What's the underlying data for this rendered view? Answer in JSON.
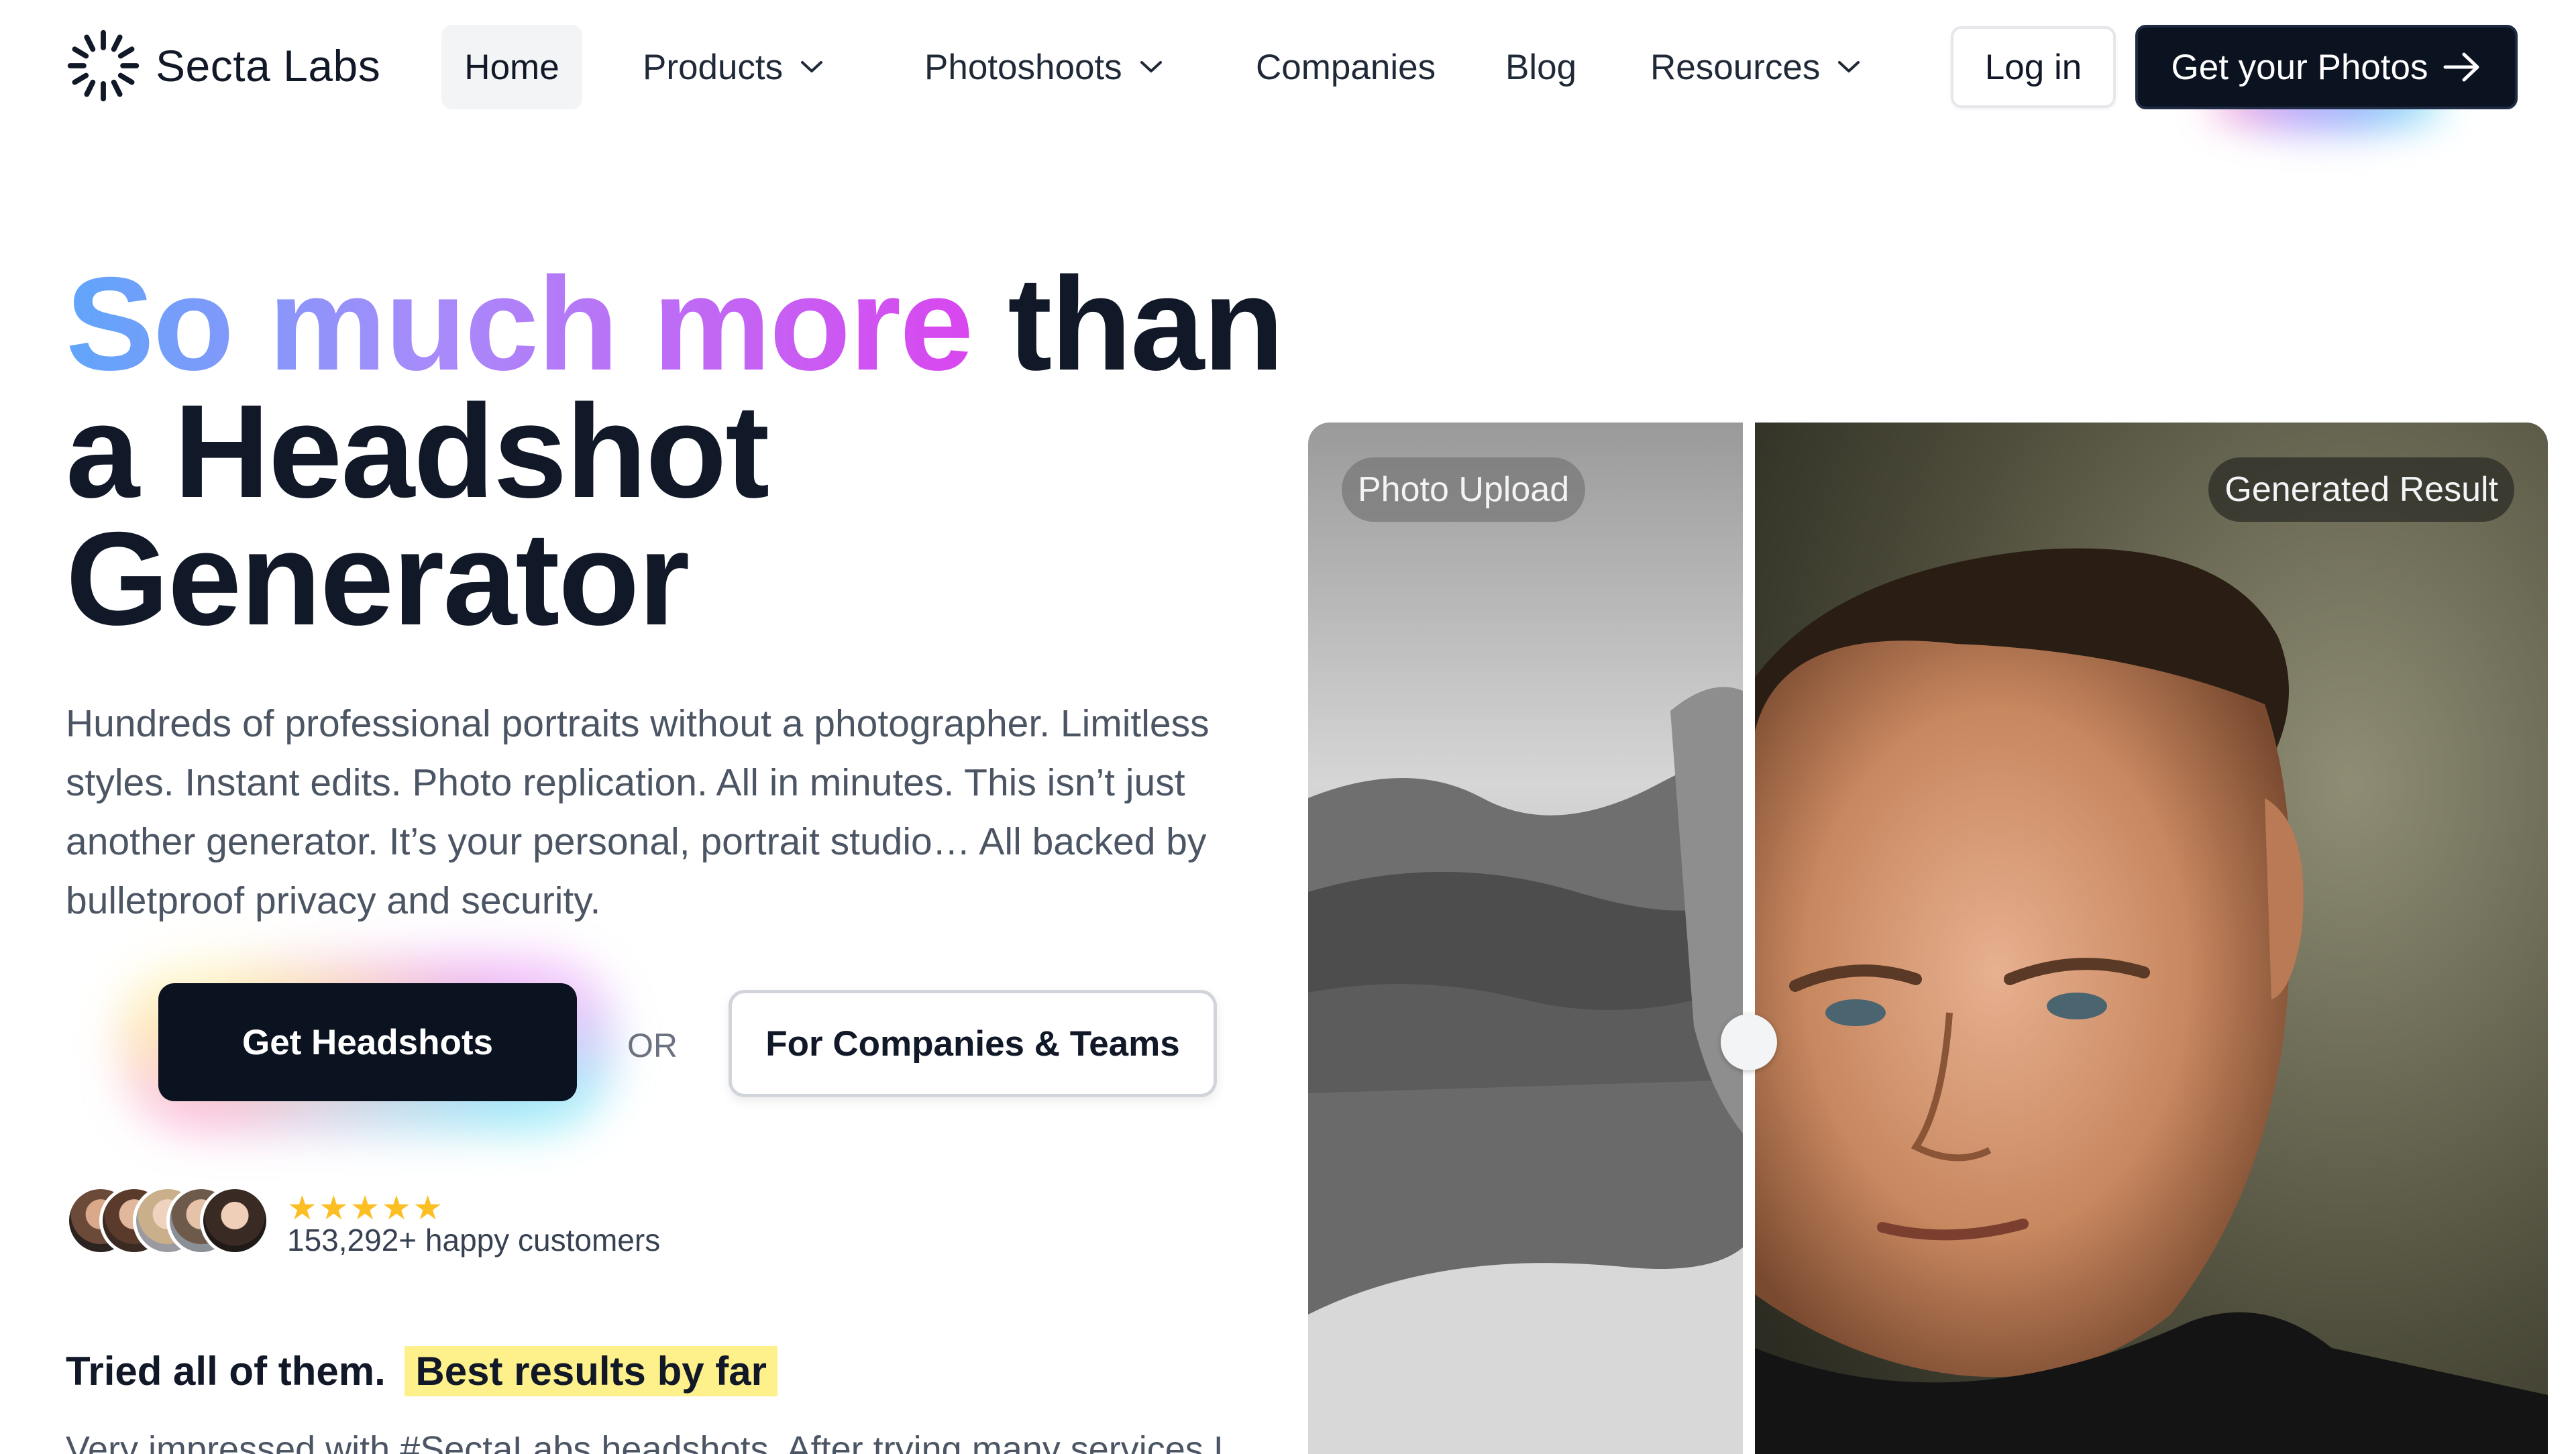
{
  "brand": {
    "name": "Secta Labs"
  },
  "nav": {
    "items": [
      {
        "label": "Home",
        "active": true
      },
      {
        "label": "Products",
        "dropdown": true
      },
      {
        "label": "Photoshoots",
        "dropdown": true
      },
      {
        "label": "Companies"
      },
      {
        "label": "Blog"
      },
      {
        "label": "Resources",
        "dropdown": true
      }
    ],
    "login_label": "Log in",
    "cta_label": "Get your Photos"
  },
  "hero": {
    "title_gradient": "So much more",
    "title_rest_line1": "than",
    "title_line2": "a Headshot",
    "title_line3": "Generator",
    "subtitle": "Hundreds of professional portraits without a photographer. Limitless styles. Instant edits. Photo replication. All in minutes. This isn’t just another generator. It’s your personal, portrait studio… All backed by bulletproof privacy and security.",
    "primary_button": "Get Headshots",
    "or_text": "OR",
    "secondary_button": "For Companies & Teams",
    "rating_stars": "★★★★★",
    "rating": 5,
    "customers_text": "153,292+ happy customers"
  },
  "testimonial": {
    "lead": "Tried all of them.",
    "highlight": "Best results by far",
    "body": "Very impressed with #SectaLabs headshots. After trying many services I"
  },
  "compare": {
    "left_label": "Photo Upload",
    "right_label": "Generated Result"
  },
  "colors": {
    "primary_dark": "#0b1220",
    "gradient_start": "#60a5fa",
    "gradient_end": "#d946ef",
    "highlight": "#fef08a",
    "star": "#fbbf24"
  }
}
